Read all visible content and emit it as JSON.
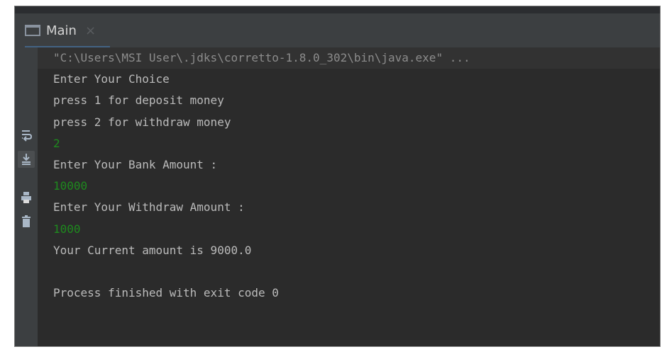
{
  "tab": {
    "label": "Main",
    "close_glyph": "×",
    "icon": "console-window-icon"
  },
  "gutter": {
    "icons": [
      "soft-wrap-icon",
      "scroll-to-end-icon",
      "print-icon",
      "clear-trash-icon"
    ]
  },
  "console": {
    "lines": [
      {
        "text": "\"C:\\Users\\MSI User\\.jdks\\corretto-1.8.0_302\\bin\\java.exe\" ...",
        "kind": "cmd"
      },
      {
        "text": "Enter Your Choice",
        "kind": "out"
      },
      {
        "text": "press 1 for deposit money",
        "kind": "out"
      },
      {
        "text": "press 2 for withdraw money",
        "kind": "out"
      },
      {
        "text": "2",
        "kind": "input"
      },
      {
        "text": "Enter Your Bank Amount :",
        "kind": "out"
      },
      {
        "text": "10000",
        "kind": "input"
      },
      {
        "text": "Enter Your Withdraw Amount :",
        "kind": "out"
      },
      {
        "text": "1000",
        "kind": "input"
      },
      {
        "text": "Your Current amount is 9000.0",
        "kind": "out"
      },
      {
        "text": "",
        "kind": "out"
      },
      {
        "text": "Process finished with exit code 0",
        "kind": "out"
      }
    ]
  },
  "colors": {
    "background": "#2b2b2b",
    "panel": "#3c3f41",
    "output_text": "#bbbbbb",
    "command_text": "#8c8c8c",
    "user_input_text": "#1e8a1e"
  }
}
